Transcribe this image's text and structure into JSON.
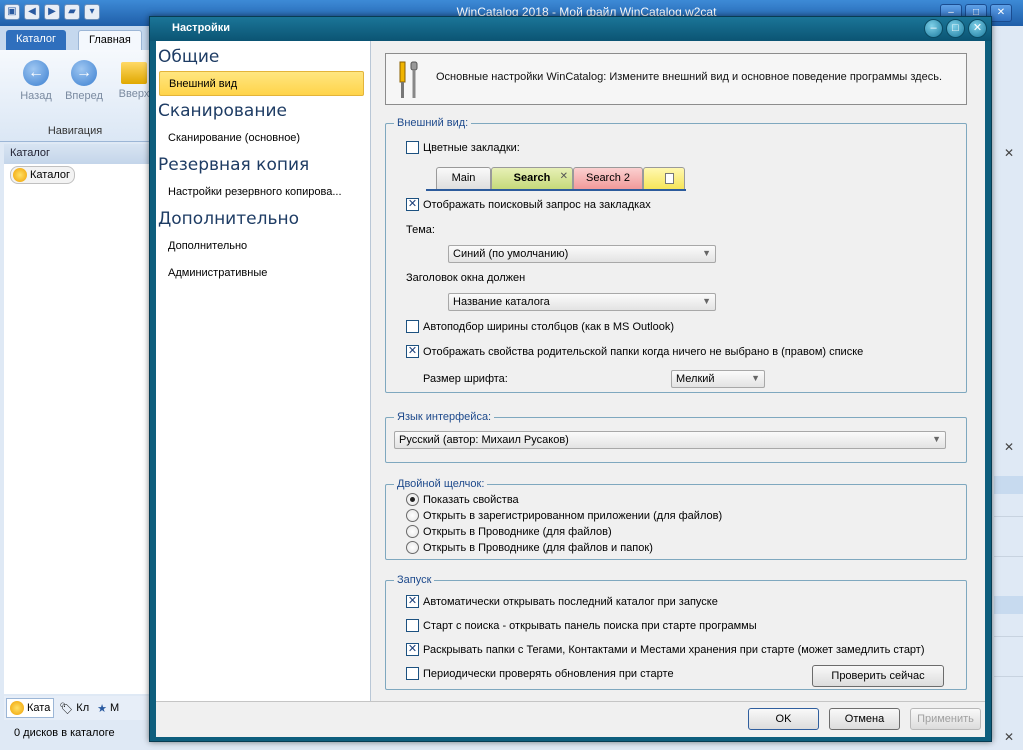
{
  "main_window": {
    "title": "WinCatalog 2018 - Мой файл WinCatalog.w2cat",
    "tabs": {
      "catalog": "Каталог",
      "home": "Главная"
    },
    "ribbon": {
      "back": "Назад",
      "forward": "Вперед",
      "up": "Вверх",
      "group": "Навигация"
    },
    "catalog_header": "Каталог",
    "tree_root": "Каталог",
    "bottom_tabs": [
      "Ката",
      "Кл",
      "М"
    ],
    "status": "0 дисков в каталоге"
  },
  "dialog": {
    "title": "Настройки",
    "nav": {
      "general": "Общие",
      "appearance": "Внешний вид",
      "scanning": "Сканирование",
      "scanning_basic": "Сканирование (основное)",
      "backup": "Резервная копия",
      "backup_settings": "Настройки резервного копирова...",
      "advanced": "Дополнительно",
      "advanced_item": "Дополнительно",
      "admin": "Административные"
    },
    "header_text": "Основные настройки WinCatalog: Измените внешний вид и основное поведение программы здесь.",
    "appearance": {
      "label": "Внешний вид:",
      "colored_tabs": {
        "label": "Цветные закладки:",
        "checked": false
      },
      "demo_tabs": {
        "main": "Main",
        "search": "Search",
        "search2": "Search 2"
      },
      "show_query": {
        "label": "Отображать поисковый запрос на закладках",
        "checked": true
      },
      "theme_label": "Тема:",
      "theme_value": "Синий (по умолчанию)",
      "title_label": "Заголовок окна должен",
      "title_value": "Название каталога",
      "autofit": {
        "label": "Автоподбор ширины столбцов (как в MS Outlook)",
        "checked": false
      },
      "parent_props": {
        "label": "Отображать свойства родительской папки когда ничего не выбрано в (правом) списке",
        "checked": true
      },
      "font_size_label": "Размер шрифта:",
      "font_size_value": "Мелкий"
    },
    "language": {
      "label": "Язык интерфейса:",
      "value": "Русский (автор: Михаил Русаков)"
    },
    "double_click": {
      "label": "Двойной щелчок:",
      "options": [
        {
          "label": "Показать свойства",
          "checked": true
        },
        {
          "label": "Открыть в зарегистрированном приложении (для файлов)",
          "checked": false
        },
        {
          "label": "Открыть в Проводнике (для файлов)",
          "checked": false
        },
        {
          "label": "Открыть в Проводнике (для файлов и папок)",
          "checked": false
        }
      ]
    },
    "startup": {
      "label": "Запуск",
      "options": [
        {
          "label": "Автоматически открывать последний каталог при запуске",
          "checked": true
        },
        {
          "label": "Старт с поиска - открывать панель поиска при старте программы",
          "checked": false
        },
        {
          "label": "Раскрывать папки с Тегами, Контактами и Местами хранения при старте (может замедлить старт)",
          "checked": true
        },
        {
          "label": "Периодически проверять обновления при старте",
          "checked": false
        }
      ],
      "check_now": "Проверить сейчас"
    },
    "buttons": {
      "ok": "OK",
      "cancel": "Отмена",
      "apply": "Применить"
    }
  }
}
